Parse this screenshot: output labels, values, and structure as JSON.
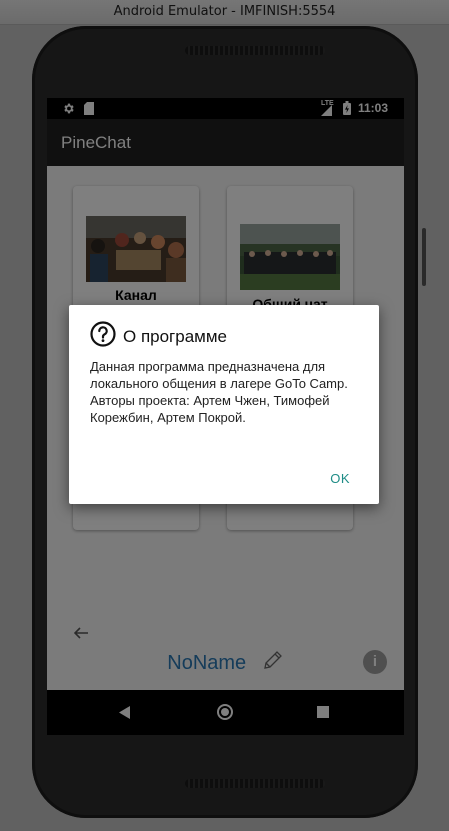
{
  "window": {
    "title": "Android Emulator - IMFINISH:5554"
  },
  "status_bar": {
    "time": "11:03",
    "network": "LTE"
  },
  "app_bar": {
    "title": "PineChat"
  },
  "cards": [
    {
      "label": "Канал"
    },
    {
      "label": "Общий чат"
    }
  ],
  "footer": {
    "username": "NoName"
  },
  "dialog": {
    "title": "О программе",
    "body_line1": "Данная программа предназначена для локального общения в лагере GoTo Camp.",
    "body_line2": "Авторы проекта: Артем Чжен, Тимофей Корежбин, Артем Покрой.",
    "ok_label": "OK"
  },
  "colors": {
    "accent": "#1e8c86",
    "username": "#2a78b4",
    "app_bar": "#212121"
  }
}
